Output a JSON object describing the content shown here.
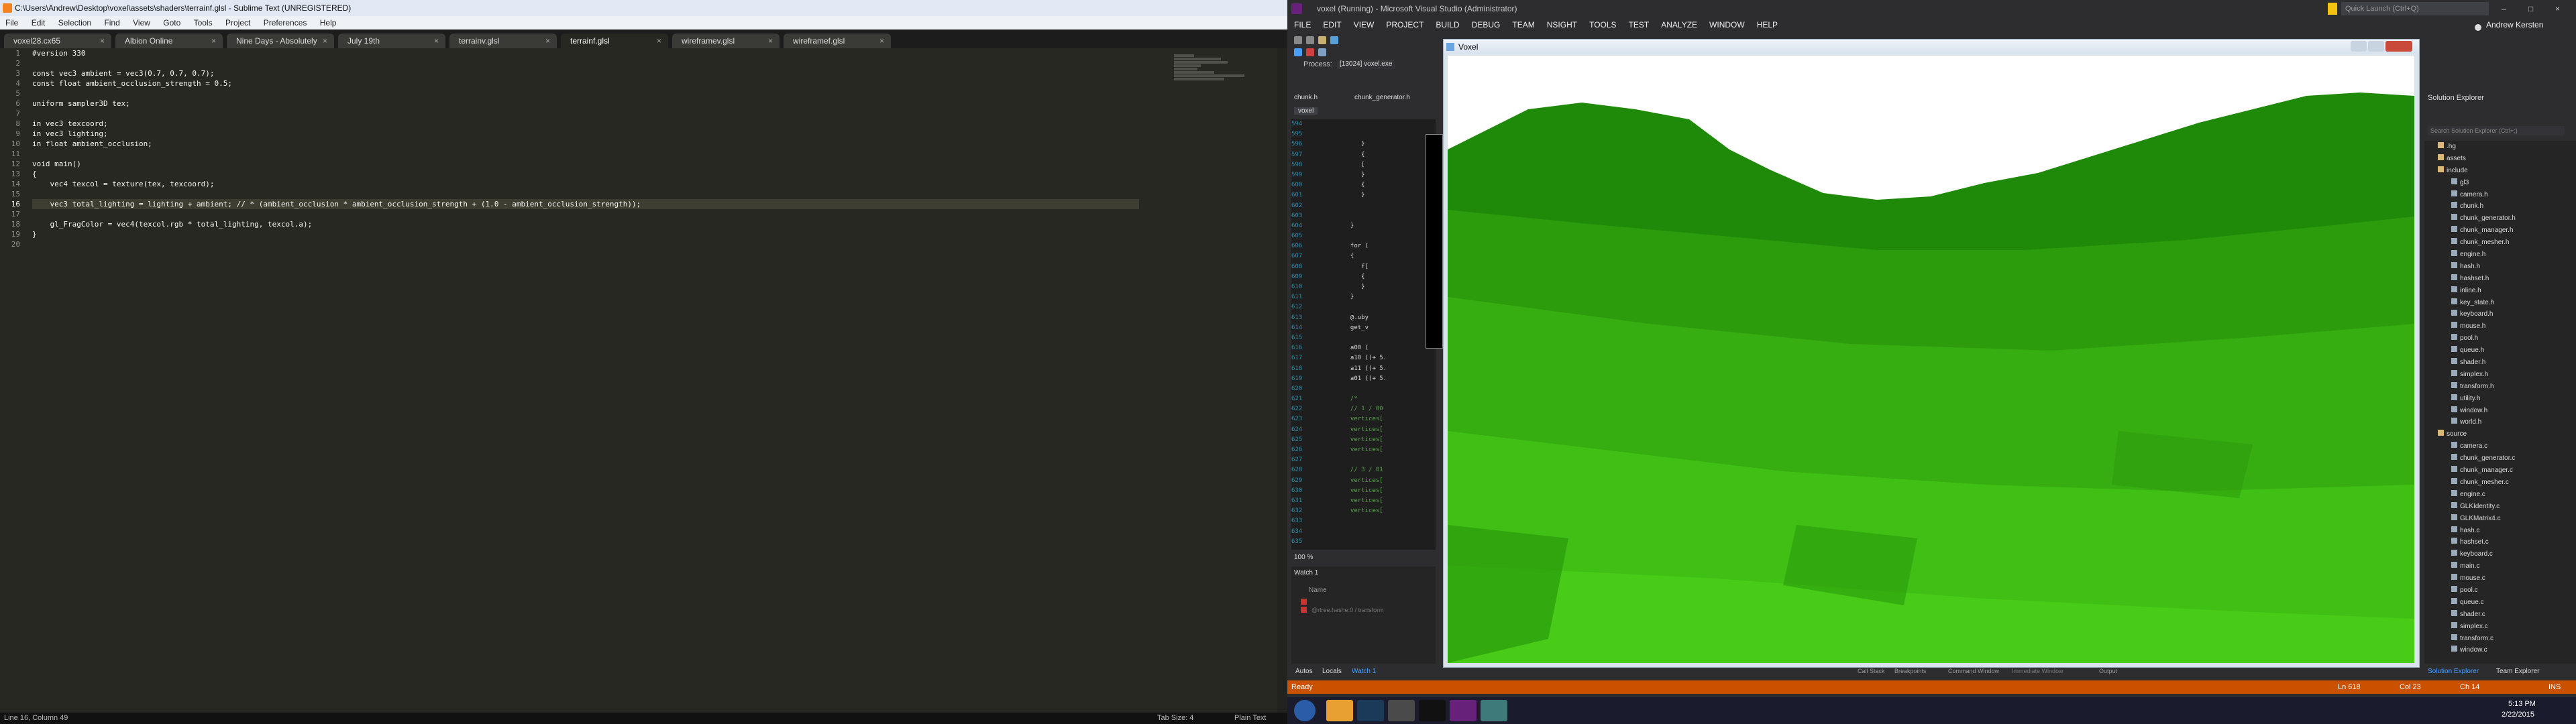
{
  "sublime": {
    "title": "C:\\Users\\Andrew\\Desktop\\voxel\\assets\\shaders\\terrainf.glsl - Sublime Text (UNREGISTERED)",
    "menu": [
      "File",
      "Edit",
      "Selection",
      "Find",
      "View",
      "Goto",
      "Tools",
      "Project",
      "Preferences",
      "Help"
    ],
    "tabs": [
      {
        "label": "voxel28.cx65"
      },
      {
        "label": "Albion Online"
      },
      {
        "label": "Nine Days - Absolutely"
      },
      {
        "label": "July 19th"
      },
      {
        "label": "terrainv.glsl"
      },
      {
        "label": "terrainf.glsl"
      },
      {
        "label": "wireframev.glsl"
      },
      {
        "label": "wireframef.glsl"
      }
    ],
    "line_numbers": [
      "1",
      "2",
      "3",
      "4",
      "5",
      "6",
      "7",
      "8",
      "9",
      "10",
      "11",
      "12",
      "13",
      "14",
      "15",
      "16",
      "17",
      "18",
      "19",
      "20"
    ],
    "code": [
      "#version 330",
      "",
      "const vec3 ambient = vec3(0.7, 0.7, 0.7);",
      "const float ambient_occlusion_strength = 0.5;",
      "",
      "uniform sampler3D tex;",
      "",
      "in vec3 texcoord;",
      "in vec3 lighting;",
      "in float ambient_occlusion;",
      "",
      "void main()",
      "{",
      "    vec4 texcol = texture(tex, texcoord);",
      "",
      "    vec3 total_lighting = lighting + ambient; // * (ambient_occlusion * ambient_occlusion_strength + (1.0 - ambient_occlusion_strength));",
      "",
      "    gl_FragColor = vec4(texcol.rgb * total_lighting, texcol.a);",
      "}",
      ""
    ],
    "status_left": "Line 16, Column 49",
    "status_tab": "Tab Size: 4",
    "status_syntax": "Plain Text"
  },
  "vs": {
    "title": "voxel (Running) - Microsoft Visual Studio (Administrator)",
    "quick_launch": "Quick Launch (Ctrl+Q)",
    "user": "Andrew Kersten",
    "menu": [
      "FILE",
      "EDIT",
      "VIEW",
      "PROJECT",
      "BUILD",
      "DEBUG",
      "TEAM",
      "NSIGHT",
      "TOOLS",
      "TEST",
      "ANALYZE",
      "WINDOW",
      "HELP"
    ],
    "process_label": "Process:",
    "process_value": "[13024] voxel.exe",
    "editor_tabs": [
      "chunk.h",
      "chunk_generator.h"
    ],
    "file_tab": "voxel",
    "vs_line_numbers": [
      "594",
      "595",
      "596",
      "597",
      "598",
      "599",
      "600",
      "601",
      "602",
      "603",
      "604",
      "605",
      "606",
      "607",
      "608",
      "609",
      "610",
      "611",
      "612",
      "613",
      "614",
      "615",
      "616",
      "617",
      "618",
      "619",
      "620",
      "621",
      "622",
      "623",
      "624",
      "625",
      "626",
      "627",
      "628",
      "629",
      "630",
      "631",
      "632",
      "633",
      "634",
      "635"
    ],
    "vs_code": [
      "",
      "",
      "          }",
      "          {",
      "          [",
      "          }",
      "          {",
      "          }",
      "",
      "",
      "       }",
      "",
      "       for (",
      "       {",
      "          f[",
      "          {",
      "          }",
      "       }",
      "",
      "       @.uby",
      "       get_v",
      "",
      "       a00 (",
      "       a10 ((+ 5.",
      "       a11 ((+ 5.",
      "       a01 ((+ 5.",
      "",
      "       /*",
      "       // 1 / 00",
      "       vertices[",
      "       vertices[",
      "       vertices[",
      "       vertices[",
      "",
      "       // 3 / 01",
      "       vertices[",
      "       vertices[",
      "       vertices[",
      "       vertices[",
      "",
      "",
      ""
    ],
    "zoom": "100 %",
    "watch_title": "Watch 1",
    "watch_col": "Name",
    "watch_item": "@rtree.hashe:0 / transform",
    "bottom_tabs": [
      "Autos",
      "Locals",
      "Watch 1"
    ],
    "bottom_tabs_right": [
      "Call Stack",
      "Breakpoints",
      "Command Window",
      "Immediate Window",
      "Output"
    ],
    "solution_title": "Solution Explorer",
    "solution_search": "Search Solution Explorer (Ctrl+;)",
    "solution_items": [
      {
        "label": ".hg",
        "indent": 1
      },
      {
        "label": "assets",
        "indent": 1
      },
      {
        "label": "include",
        "indent": 1
      },
      {
        "label": "gl3",
        "indent": 2
      },
      {
        "label": "camera.h",
        "indent": 2
      },
      {
        "label": "chunk.h",
        "indent": 2
      },
      {
        "label": "chunk_generator.h",
        "indent": 2
      },
      {
        "label": "chunk_manager.h",
        "indent": 2
      },
      {
        "label": "chunk_mesher.h",
        "indent": 2
      },
      {
        "label": "engine.h",
        "indent": 2
      },
      {
        "label": "hash.h",
        "indent": 2
      },
      {
        "label": "hashset.h",
        "indent": 2
      },
      {
        "label": "inline.h",
        "indent": 2
      },
      {
        "label": "key_state.h",
        "indent": 2
      },
      {
        "label": "keyboard.h",
        "indent": 2
      },
      {
        "label": "mouse.h",
        "indent": 2
      },
      {
        "label": "pool.h",
        "indent": 2
      },
      {
        "label": "queue.h",
        "indent": 2
      },
      {
        "label": "shader.h",
        "indent": 2
      },
      {
        "label": "simplex.h",
        "indent": 2
      },
      {
        "label": "transform.h",
        "indent": 2
      },
      {
        "label": "utility.h",
        "indent": 2
      },
      {
        "label": "window.h",
        "indent": 2
      },
      {
        "label": "world.h",
        "indent": 2
      },
      {
        "label": "source",
        "indent": 1
      },
      {
        "label": "camera.c",
        "indent": 2
      },
      {
        "label": "chunk_generator.c",
        "indent": 2
      },
      {
        "label": "chunk_manager.c",
        "indent": 2
      },
      {
        "label": "chunk_mesher.c",
        "indent": 2
      },
      {
        "label": "engine.c",
        "indent": 2
      },
      {
        "label": "GLKIdentity.c",
        "indent": 2
      },
      {
        "label": "GLKMatrix4.c",
        "indent": 2
      },
      {
        "label": "hash.c",
        "indent": 2
      },
      {
        "label": "hashset.c",
        "indent": 2
      },
      {
        "label": "keyboard.c",
        "indent": 2
      },
      {
        "label": "main.c",
        "indent": 2
      },
      {
        "label": "mouse.c",
        "indent": 2
      },
      {
        "label": "pool.c",
        "indent": 2
      },
      {
        "label": "queue.c",
        "indent": 2
      },
      {
        "label": "shader.c",
        "indent": 2
      },
      {
        "label": "simplex.c",
        "indent": 2
      },
      {
        "label": "transform.c",
        "indent": 2
      },
      {
        "label": "window.c",
        "indent": 2
      }
    ],
    "solution_tabs": [
      "Solution Explorer",
      "Team Explorer"
    ],
    "status_ready": "Ready",
    "status_ln": "Ln 618",
    "status_col": "Col 23",
    "status_ch": "Ch 14",
    "status_ins": "INS",
    "game_title": "Voxel",
    "clock_time": "5:13 PM",
    "clock_date": "2/22/2015"
  },
  "colors": {
    "accent": "#ca5100",
    "sublime_bg": "#272822",
    "vs_bg": "#2d2d30",
    "terrain": "#3fc010",
    "sky": "#ffffff"
  }
}
